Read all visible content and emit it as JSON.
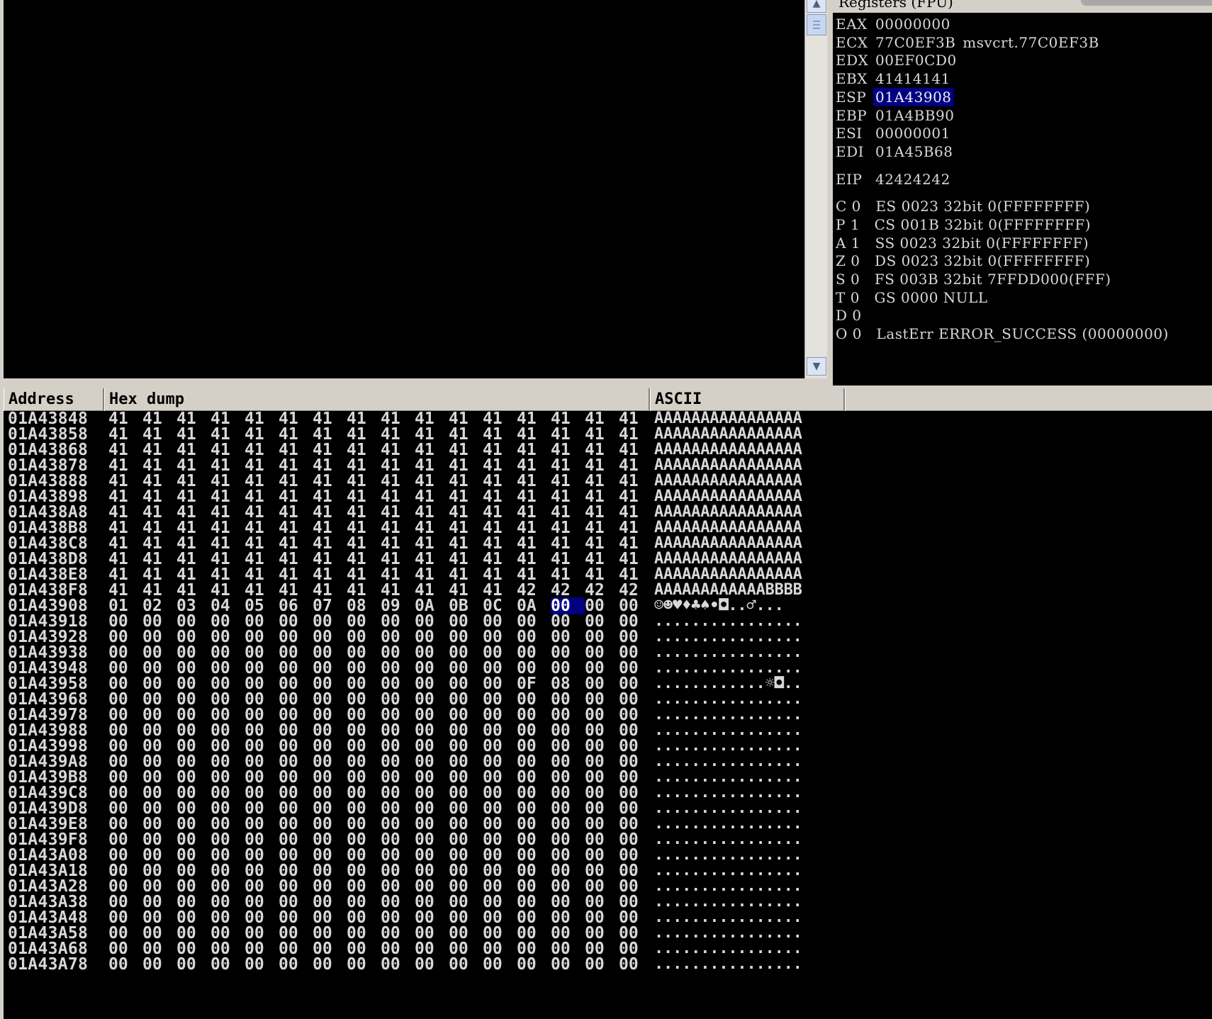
{
  "registers": {
    "title": "Registers (FPU)",
    "general": [
      {
        "name": "EAX",
        "value": "00000000",
        "comment": ""
      },
      {
        "name": "ECX",
        "value": "77C0EF3B",
        "comment": "msvcrt.77C0EF3B"
      },
      {
        "name": "EDX",
        "value": "00EF0CD0",
        "comment": ""
      },
      {
        "name": "EBX",
        "value": "41414141",
        "comment": ""
      },
      {
        "name": "ESP",
        "value": "01A43908",
        "comment": "",
        "selected": true
      },
      {
        "name": "EBP",
        "value": "01A4BB90",
        "comment": ""
      },
      {
        "name": "ESI",
        "value": "00000001",
        "comment": ""
      },
      {
        "name": "EDI",
        "value": "01A45B68",
        "comment": ""
      }
    ],
    "eip": {
      "name": "EIP",
      "value": "42424242"
    },
    "flags": [
      "C 0   ES 0023 32bit 0(FFFFFFFF)",
      "P 1   CS 001B 32bit 0(FFFFFFFF)",
      "A 1   SS 0023 32bit 0(FFFFFFFF)",
      "Z 0   DS 0023 32bit 0(FFFFFFFF)",
      "S 0   FS 003B 32bit 7FFDD000(FFF)",
      "T 0   GS 0000 NULL",
      "D 0",
      "O 0   LastErr ERROR_SUCCESS (00000000)"
    ]
  },
  "dump": {
    "headers": {
      "address": "Address",
      "hex": "Hex dump",
      "ascii": "ASCII"
    },
    "rows": [
      {
        "address": "01A43848",
        "bytes": [
          "41",
          "41",
          "41",
          "41",
          "41",
          "41",
          "41",
          "41",
          "41",
          "41",
          "41",
          "41",
          "41",
          "41",
          "41",
          "41"
        ],
        "ascii": "AAAAAAAAAAAAAAAA"
      },
      {
        "address": "01A43858",
        "bytes": [
          "41",
          "41",
          "41",
          "41",
          "41",
          "41",
          "41",
          "41",
          "41",
          "41",
          "41",
          "41",
          "41",
          "41",
          "41",
          "41"
        ],
        "ascii": "AAAAAAAAAAAAAAAA"
      },
      {
        "address": "01A43868",
        "bytes": [
          "41",
          "41",
          "41",
          "41",
          "41",
          "41",
          "41",
          "41",
          "41",
          "41",
          "41",
          "41",
          "41",
          "41",
          "41",
          "41"
        ],
        "ascii": "AAAAAAAAAAAAAAAA"
      },
      {
        "address": "01A43878",
        "bytes": [
          "41",
          "41",
          "41",
          "41",
          "41",
          "41",
          "41",
          "41",
          "41",
          "41",
          "41",
          "41",
          "41",
          "41",
          "41",
          "41"
        ],
        "ascii": "AAAAAAAAAAAAAAAA"
      },
      {
        "address": "01A43888",
        "bytes": [
          "41",
          "41",
          "41",
          "41",
          "41",
          "41",
          "41",
          "41",
          "41",
          "41",
          "41",
          "41",
          "41",
          "41",
          "41",
          "41"
        ],
        "ascii": "AAAAAAAAAAAAAAAA"
      },
      {
        "address": "01A43898",
        "bytes": [
          "41",
          "41",
          "41",
          "41",
          "41",
          "41",
          "41",
          "41",
          "41",
          "41",
          "41",
          "41",
          "41",
          "41",
          "41",
          "41"
        ],
        "ascii": "AAAAAAAAAAAAAAAA"
      },
      {
        "address": "01A438A8",
        "bytes": [
          "41",
          "41",
          "41",
          "41",
          "41",
          "41",
          "41",
          "41",
          "41",
          "41",
          "41",
          "41",
          "41",
          "41",
          "41",
          "41"
        ],
        "ascii": "AAAAAAAAAAAAAAAA"
      },
      {
        "address": "01A438B8",
        "bytes": [
          "41",
          "41",
          "41",
          "41",
          "41",
          "41",
          "41",
          "41",
          "41",
          "41",
          "41",
          "41",
          "41",
          "41",
          "41",
          "41"
        ],
        "ascii": "AAAAAAAAAAAAAAAA"
      },
      {
        "address": "01A438C8",
        "bytes": [
          "41",
          "41",
          "41",
          "41",
          "41",
          "41",
          "41",
          "41",
          "41",
          "41",
          "41",
          "41",
          "41",
          "41",
          "41",
          "41"
        ],
        "ascii": "AAAAAAAAAAAAAAAA"
      },
      {
        "address": "01A438D8",
        "bytes": [
          "41",
          "41",
          "41",
          "41",
          "41",
          "41",
          "41",
          "41",
          "41",
          "41",
          "41",
          "41",
          "41",
          "41",
          "41",
          "41"
        ],
        "ascii": "AAAAAAAAAAAAAAAA"
      },
      {
        "address": "01A438E8",
        "bytes": [
          "41",
          "41",
          "41",
          "41",
          "41",
          "41",
          "41",
          "41",
          "41",
          "41",
          "41",
          "41",
          "41",
          "41",
          "41",
          "41"
        ],
        "ascii": "AAAAAAAAAAAAAAAA"
      },
      {
        "address": "01A438F8",
        "bytes": [
          "41",
          "41",
          "41",
          "41",
          "41",
          "41",
          "41",
          "41",
          "41",
          "41",
          "41",
          "41",
          "42",
          "42",
          "42",
          "42"
        ],
        "ascii": "AAAAAAAAAAAABBBB"
      },
      {
        "address": "01A43908",
        "bytes": [
          "01",
          "02",
          "03",
          "04",
          "05",
          "06",
          "07",
          "08",
          "09",
          "0A",
          "0B",
          "0C",
          "0A",
          "00",
          "00",
          "00"
        ],
        "ascii": "☺☻♥♦♣♠•◘..♂...",
        "selected_index": 13,
        "ascii_selected_index": 13
      },
      {
        "address": "01A43918",
        "bytes": [
          "00",
          "00",
          "00",
          "00",
          "00",
          "00",
          "00",
          "00",
          "00",
          "00",
          "00",
          "00",
          "00",
          "00",
          "00",
          "00"
        ],
        "ascii": "................"
      },
      {
        "address": "01A43928",
        "bytes": [
          "00",
          "00",
          "00",
          "00",
          "00",
          "00",
          "00",
          "00",
          "00",
          "00",
          "00",
          "00",
          "00",
          "00",
          "00",
          "00"
        ],
        "ascii": "................"
      },
      {
        "address": "01A43938",
        "bytes": [
          "00",
          "00",
          "00",
          "00",
          "00",
          "00",
          "00",
          "00",
          "00",
          "00",
          "00",
          "00",
          "00",
          "00",
          "00",
          "00"
        ],
        "ascii": "................"
      },
      {
        "address": "01A43948",
        "bytes": [
          "00",
          "00",
          "00",
          "00",
          "00",
          "00",
          "00",
          "00",
          "00",
          "00",
          "00",
          "00",
          "00",
          "00",
          "00",
          "00"
        ],
        "ascii": "................"
      },
      {
        "address": "01A43958",
        "bytes": [
          "00",
          "00",
          "00",
          "00",
          "00",
          "00",
          "00",
          "00",
          "00",
          "00",
          "00",
          "00",
          "0F",
          "08",
          "00",
          "00"
        ],
        "ascii": "............☼◘.."
      },
      {
        "address": "01A43968",
        "bytes": [
          "00",
          "00",
          "00",
          "00",
          "00",
          "00",
          "00",
          "00",
          "00",
          "00",
          "00",
          "00",
          "00",
          "00",
          "00",
          "00"
        ],
        "ascii": "................"
      },
      {
        "address": "01A43978",
        "bytes": [
          "00",
          "00",
          "00",
          "00",
          "00",
          "00",
          "00",
          "00",
          "00",
          "00",
          "00",
          "00",
          "00",
          "00",
          "00",
          "00"
        ],
        "ascii": "................"
      },
      {
        "address": "01A43988",
        "bytes": [
          "00",
          "00",
          "00",
          "00",
          "00",
          "00",
          "00",
          "00",
          "00",
          "00",
          "00",
          "00",
          "00",
          "00",
          "00",
          "00"
        ],
        "ascii": "................"
      },
      {
        "address": "01A43998",
        "bytes": [
          "00",
          "00",
          "00",
          "00",
          "00",
          "00",
          "00",
          "00",
          "00",
          "00",
          "00",
          "00",
          "00",
          "00",
          "00",
          "00"
        ],
        "ascii": "................"
      },
      {
        "address": "01A439A8",
        "bytes": [
          "00",
          "00",
          "00",
          "00",
          "00",
          "00",
          "00",
          "00",
          "00",
          "00",
          "00",
          "00",
          "00",
          "00",
          "00",
          "00"
        ],
        "ascii": "................"
      },
      {
        "address": "01A439B8",
        "bytes": [
          "00",
          "00",
          "00",
          "00",
          "00",
          "00",
          "00",
          "00",
          "00",
          "00",
          "00",
          "00",
          "00",
          "00",
          "00",
          "00"
        ],
        "ascii": "................"
      },
      {
        "address": "01A439C8",
        "bytes": [
          "00",
          "00",
          "00",
          "00",
          "00",
          "00",
          "00",
          "00",
          "00",
          "00",
          "00",
          "00",
          "00",
          "00",
          "00",
          "00"
        ],
        "ascii": "................"
      },
      {
        "address": "01A439D8",
        "bytes": [
          "00",
          "00",
          "00",
          "00",
          "00",
          "00",
          "00",
          "00",
          "00",
          "00",
          "00",
          "00",
          "00",
          "00",
          "00",
          "00"
        ],
        "ascii": "................"
      },
      {
        "address": "01A439E8",
        "bytes": [
          "00",
          "00",
          "00",
          "00",
          "00",
          "00",
          "00",
          "00",
          "00",
          "00",
          "00",
          "00",
          "00",
          "00",
          "00",
          "00"
        ],
        "ascii": "................"
      },
      {
        "address": "01A439F8",
        "bytes": [
          "00",
          "00",
          "00",
          "00",
          "00",
          "00",
          "00",
          "00",
          "00",
          "00",
          "00",
          "00",
          "00",
          "00",
          "00",
          "00"
        ],
        "ascii": "................"
      },
      {
        "address": "01A43A08",
        "bytes": [
          "00",
          "00",
          "00",
          "00",
          "00",
          "00",
          "00",
          "00",
          "00",
          "00",
          "00",
          "00",
          "00",
          "00",
          "00",
          "00"
        ],
        "ascii": "................"
      },
      {
        "address": "01A43A18",
        "bytes": [
          "00",
          "00",
          "00",
          "00",
          "00",
          "00",
          "00",
          "00",
          "00",
          "00",
          "00",
          "00",
          "00",
          "00",
          "00",
          "00"
        ],
        "ascii": "................"
      },
      {
        "address": "01A43A28",
        "bytes": [
          "00",
          "00",
          "00",
          "00",
          "00",
          "00",
          "00",
          "00",
          "00",
          "00",
          "00",
          "00",
          "00",
          "00",
          "00",
          "00"
        ],
        "ascii": "................"
      },
      {
        "address": "01A43A38",
        "bytes": [
          "00",
          "00",
          "00",
          "00",
          "00",
          "00",
          "00",
          "00",
          "00",
          "00",
          "00",
          "00",
          "00",
          "00",
          "00",
          "00"
        ],
        "ascii": "................"
      },
      {
        "address": "01A43A48",
        "bytes": [
          "00",
          "00",
          "00",
          "00",
          "00",
          "00",
          "00",
          "00",
          "00",
          "00",
          "00",
          "00",
          "00",
          "00",
          "00",
          "00"
        ],
        "ascii": "................"
      },
      {
        "address": "01A43A58",
        "bytes": [
          "00",
          "00",
          "00",
          "00",
          "00",
          "00",
          "00",
          "00",
          "00",
          "00",
          "00",
          "00",
          "00",
          "00",
          "00",
          "00"
        ],
        "ascii": "................"
      },
      {
        "address": "01A43A68",
        "bytes": [
          "00",
          "00",
          "00",
          "00",
          "00",
          "00",
          "00",
          "00",
          "00",
          "00",
          "00",
          "00",
          "00",
          "00",
          "00",
          "00"
        ],
        "ascii": "................"
      },
      {
        "address": "01A43A78",
        "bytes": [
          "00",
          "00",
          "00",
          "00",
          "00",
          "00",
          "00",
          "00",
          "00",
          "00",
          "00",
          "00",
          "00",
          "00",
          "00",
          "00"
        ],
        "ascii": "................"
      }
    ]
  },
  "icons": {
    "scroll_up": "chevron-up-icon",
    "scroll_down": "chevron-down-icon"
  },
  "colors": {
    "pane_bg": "#000000",
    "text": "#d8d8d8",
    "selection": "#000080",
    "chrome": "#d4d0c8"
  }
}
